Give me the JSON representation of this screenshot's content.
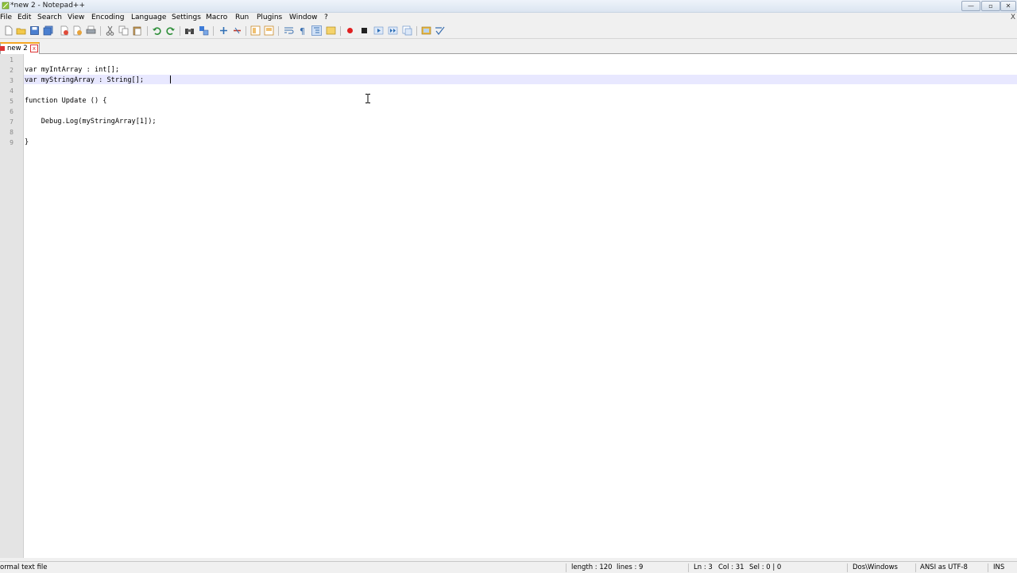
{
  "window": {
    "title": "*new 2 - Notepad++",
    "controls": {
      "minimize": "—",
      "maximize": "▫",
      "close": "✕"
    }
  },
  "menu": {
    "items": [
      "File",
      "Edit",
      "Search",
      "View",
      "Encoding",
      "Language",
      "Settings",
      "Macro",
      "Run",
      "Plugins",
      "Window",
      "?"
    ],
    "close_doc": "X"
  },
  "toolbar": {
    "icons": [
      "new-file-icon",
      "open-file-icon",
      "save-icon",
      "save-all-icon",
      "close-icon",
      "close-all-icon",
      "print-icon",
      "cut-icon",
      "copy-icon",
      "paste-icon",
      "undo-icon",
      "redo-icon",
      "find-icon",
      "replace-icon",
      "zoom-in-icon",
      "zoom-out-icon",
      "sync-vertical-icon",
      "sync-horizontal-icon",
      "word-wrap-icon",
      "show-all-chars-icon",
      "indent-guide-icon",
      "doc-map-icon",
      "record-macro-icon",
      "stop-record-icon",
      "play-macro-icon",
      "run-macro-multiple-icon",
      "save-macro-icon",
      "launch-browser-icon",
      "spellcheck-icon"
    ]
  },
  "tabs": [
    {
      "label": "new 2",
      "modified": true,
      "close": "x"
    }
  ],
  "editor": {
    "line_numbers": [
      "1",
      "2",
      "3",
      "4",
      "5",
      "6",
      "7",
      "8",
      "9"
    ],
    "lines": [
      "",
      "var myIntArray : int[];",
      "var myStringArray : String[];",
      "",
      "function Update () {",
      "",
      "    Debug.Log(myStringArray[1]);",
      "",
      "}"
    ],
    "current_line": 3
  },
  "status": {
    "file_type": "ormal text file",
    "length": "length : 120",
    "lines": "lines : 9",
    "ln": "Ln : 3",
    "col": "Col : 31",
    "sel": "Sel : 0 | 0",
    "eol": "Dos\\Windows",
    "encoding": "ANSI as UTF-8",
    "mode": "INS"
  },
  "colors": {
    "current_line": "#e8e8ff",
    "tab_accent": "#f5a623",
    "gutter": "#e4e4e4"
  }
}
